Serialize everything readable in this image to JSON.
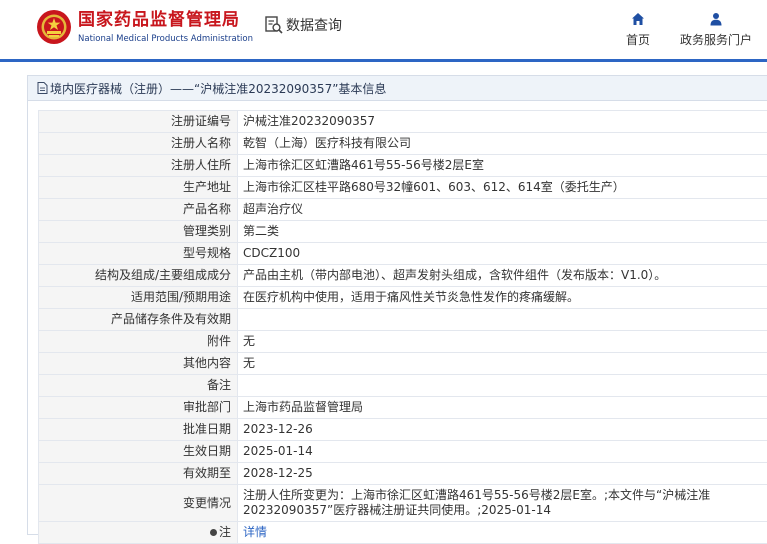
{
  "header": {
    "brand_cn": "国家药品监督管理局",
    "brand_en": "National Medical Products Administration",
    "query_label": "数据查询",
    "nav": [
      {
        "label": "首页",
        "icon": "home-icon"
      },
      {
        "label": "政务服务门户",
        "icon": "user-icon"
      }
    ]
  },
  "colors": {
    "brand_red": "#c8161d",
    "brand_blue": "#2d66c4",
    "label_bg": "#f5f5f5"
  },
  "panel": {
    "title": "境内医疗器械（注册）——“沪械注准20232090357”基本信息",
    "rows": [
      {
        "label": "注册证编号",
        "value": "沪械注准20232090357"
      },
      {
        "label": "注册人名称",
        "value": "乾智（上海）医疗科技有限公司"
      },
      {
        "label": "注册人住所",
        "value": "上海市徐汇区虹漕路461号55-56号楼2层E室"
      },
      {
        "label": "生产地址",
        "value": "上海市徐汇区桂平路680号32幢601、603、612、614室（委托生产）"
      },
      {
        "label": "产品名称",
        "value": "超声治疗仪"
      },
      {
        "label": "管理类别",
        "value": "第二类"
      },
      {
        "label": "型号规格",
        "value": "CDCZ100"
      },
      {
        "label": "结构及组成/主要组成成分",
        "value": "产品由主机（带内部电池）、超声发射头组成，含软件组件（发布版本：V1.0）。"
      },
      {
        "label": "适用范围/预期用途",
        "value": "在医疗机构中使用，适用于痛风性关节炎急性发作的疼痛缓解。"
      },
      {
        "label": "产品储存条件及有效期",
        "value": ""
      },
      {
        "label": "附件",
        "value": "无"
      },
      {
        "label": "其他内容",
        "value": "无"
      },
      {
        "label": "备注",
        "value": ""
      },
      {
        "label": "审批部门",
        "value": "上海市药品监督管理局"
      },
      {
        "label": "批准日期",
        "value": "2023-12-26"
      },
      {
        "label": "生效日期",
        "value": "2025-01-14"
      },
      {
        "label": "有效期至",
        "value": "2028-12-25"
      },
      {
        "label": "变更情况",
        "value": "注册人住所变更为：上海市徐汇区虹漕路461号55-56号楼2层E室。;本文件与“沪械注准20232090357”医疗器械注册证共同使用。;2025-01-14"
      }
    ],
    "note_label": "注",
    "note_link": "详情"
  }
}
